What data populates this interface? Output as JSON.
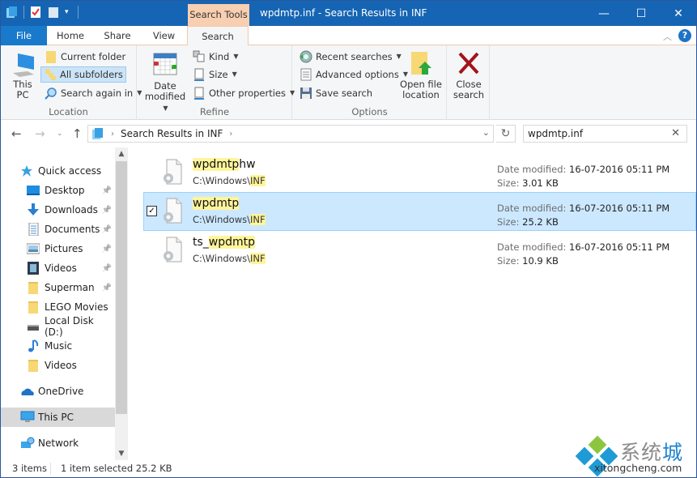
{
  "window": {
    "title": "wpdmtp.inf - Search Results in INF",
    "context_tab": "Search Tools",
    "minimize": "—",
    "maximize": "☐",
    "close": "✕"
  },
  "ribbon_tabs": [
    {
      "label": "File"
    },
    {
      "label": "Home"
    },
    {
      "label": "Share"
    },
    {
      "label": "View"
    },
    {
      "label": "Search",
      "active": true
    }
  ],
  "ribbon": {
    "location": {
      "label": "Location",
      "this_pc_line1": "This",
      "this_pc_line2": "PC",
      "current_folder": "Current folder",
      "all_subfolders": "All subfolders",
      "search_again_in": "Search again in"
    },
    "refine": {
      "label": "Refine",
      "date_modified_line1": "Date",
      "date_modified_line2": "modified",
      "kind": "Kind",
      "size": "Size",
      "other_properties": "Other properties"
    },
    "options": {
      "label": "Options",
      "recent_searches": "Recent searches",
      "advanced_options": "Advanced options",
      "save_search": "Save search",
      "open_file_location_line1": "Open file",
      "open_file_location_line2": "location"
    },
    "close_search": {
      "line1": "Close",
      "line2": "search"
    }
  },
  "address": {
    "breadcrumb": "Search Results in INF",
    "search_value": "wpdmtp.inf"
  },
  "nav_pane": {
    "items": [
      {
        "label": "Quick access",
        "icon": "star-icon"
      },
      {
        "label": "Desktop",
        "icon": "desktop-icon",
        "pinned": true
      },
      {
        "label": "Downloads",
        "icon": "downloads-icon",
        "pinned": true
      },
      {
        "label": "Documents",
        "icon": "documents-icon",
        "pinned": true
      },
      {
        "label": "Pictures",
        "icon": "pictures-icon",
        "pinned": true
      },
      {
        "label": "Videos",
        "icon": "videos-icon",
        "pinned": true
      },
      {
        "label": "Superman",
        "icon": "folder-icon",
        "pinned": true
      },
      {
        "label": "LEGO Movies",
        "icon": "folder-icon"
      },
      {
        "label": "Local Disk (D:)",
        "icon": "drive-icon"
      },
      {
        "label": "Music",
        "icon": "music-icon"
      },
      {
        "label": "Videos",
        "icon": "folder-icon"
      },
      {
        "label": "OneDrive",
        "icon": "cloud-icon"
      },
      {
        "label": "This PC",
        "icon": "computer-icon",
        "selected": true
      },
      {
        "label": "Network",
        "icon": "network-icon"
      }
    ]
  },
  "results": [
    {
      "name_highlight": "wpdmtp",
      "name_rest": "hw",
      "name_prefix": "",
      "path_prefix": "C:\\Windows\\",
      "path_highlight": "INF",
      "date_label": "Date modified:",
      "date": "16-07-2016 05:11 PM",
      "size_label": "Size:",
      "size": "3.01 KB",
      "selected": false
    },
    {
      "name_highlight": "wpdmtp",
      "name_rest": "",
      "name_prefix": "",
      "path_prefix": "C:\\Windows\\",
      "path_highlight": "INF",
      "date_label": "Date modified:",
      "date": "16-07-2016 05:11 PM",
      "size_label": "Size:",
      "size": "25.2 KB",
      "selected": true
    },
    {
      "name_highlight": "wpdmtp",
      "name_rest": "",
      "name_prefix": "ts_",
      "path_prefix": "C:\\Windows\\",
      "path_highlight": "INF",
      "date_label": "Date modified:",
      "date": "16-07-2016 05:11 PM",
      "size_label": "Size:",
      "size": "10.9 KB",
      "selected": false
    }
  ],
  "status": {
    "item_count": "3 items",
    "selection": "1 item selected  25.2 KB"
  },
  "watermark": {
    "cn_gray": "系统",
    "cn_blue": "城",
    "en": "xitongcheng.com"
  },
  "colors": {
    "titlebar": "#1565b4",
    "file_tab": "#1979ca",
    "context_tab": "#f8cfb0",
    "selection": "#cce8ff",
    "highlight": "#fff59a"
  }
}
